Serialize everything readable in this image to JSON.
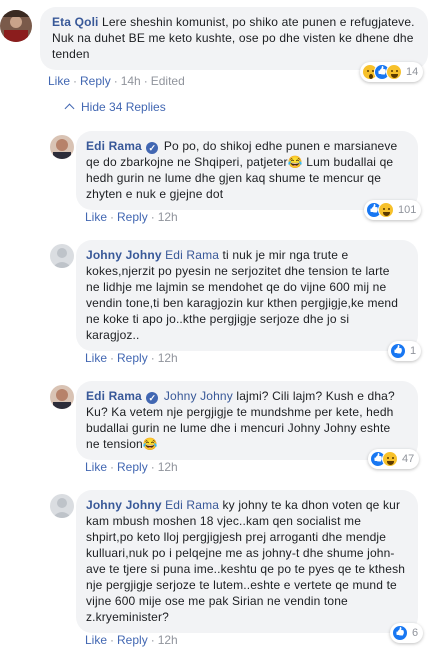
{
  "comments": [
    {
      "author": "Eta Qoli",
      "text": "Lere sheshin komunist, po shiko ate punen e refugjateve. Nuk na duhet BE me keto kushte, ose po dhe visten ke dhene dhe tenden",
      "actions": {
        "like": "Like",
        "reply": "Reply",
        "time": "14h",
        "edited": "Edited"
      },
      "reaction_count": "14",
      "reaction_icons": [
        "wow-icon",
        "like-icon",
        "haha-icon"
      ]
    },
    {
      "author": "Edi Rama",
      "verified": true,
      "text": "Po po, do shikoj edhe punen e marsianeve qe do zbarkojne ne Shqiperi, patjeter😂 Lum budallai qe hedh gurin ne lume dhe gjen kaq shume te mencur qe zhyten e nuk e gjejne dot",
      "actions": {
        "like": "Like",
        "reply": "Reply",
        "time": "12h"
      },
      "reaction_count": "101",
      "reaction_icons": [
        "like-icon",
        "haha-icon"
      ]
    },
    {
      "author": "Johny Johny",
      "mention": "Edi Rama",
      "text": "ti nuk je mir nga trute e kokes,njerzit po pyesin ne serjozitet dhe tension te larte ne lidhje me lajmin se mendohet qe do vijne 600 mij ne vendin tone,ti ben karagjozin kur kthen pergjigje,ke mend ne koke ti apo jo..kthe pergjigje serjoze dhe jo si karagjoz..",
      "actions": {
        "like": "Like",
        "reply": "Reply",
        "time": "12h"
      },
      "reaction_count": "1",
      "reaction_icons": [
        "like-icon"
      ]
    },
    {
      "author": "Edi Rama",
      "verified": true,
      "mention": "Johny Johny",
      "text": "lajmi? Cili lajm? Kush e dha? Ku? Ka vetem nje pergjigje te mundshme per kete, hedh budallai gurin ne lume dhe i mencuri Johny Johny eshte ne tension😂",
      "actions": {
        "like": "Like",
        "reply": "Reply",
        "time": "12h"
      },
      "reaction_count": "47",
      "reaction_icons": [
        "like-icon",
        "haha-icon"
      ]
    },
    {
      "author": "Johny Johny",
      "mention": "Edi Rama",
      "text": "ky johny te ka dhon voten qe kur kam mbush moshen 18 vjec..kam qen socialist me shpirt,po keto lloj pergjigjesh prej arroganti dhe mendje kulluari,nuk po i pelqejne me as johny-t dhe shume john-ave te tjere si puna ime..keshtu qe po te pyes qe te kthesh nje pergjigje serjoze te lutem..eshte e vertete qe mund te vijne 600 mije ose me pak Sirian ne vendin tone z.kryeminister?",
      "actions": {
        "like": "Like",
        "reply": "Reply",
        "time": "12h"
      },
      "reaction_count": "6",
      "reaction_icons": [
        "like-icon"
      ]
    }
  ],
  "hide_replies_label": "Hide 34 Replies",
  "colors": {
    "link": "#385898",
    "action_link": "#4267b2",
    "bubble": "#f2f3f5",
    "meta": "#90949c"
  }
}
